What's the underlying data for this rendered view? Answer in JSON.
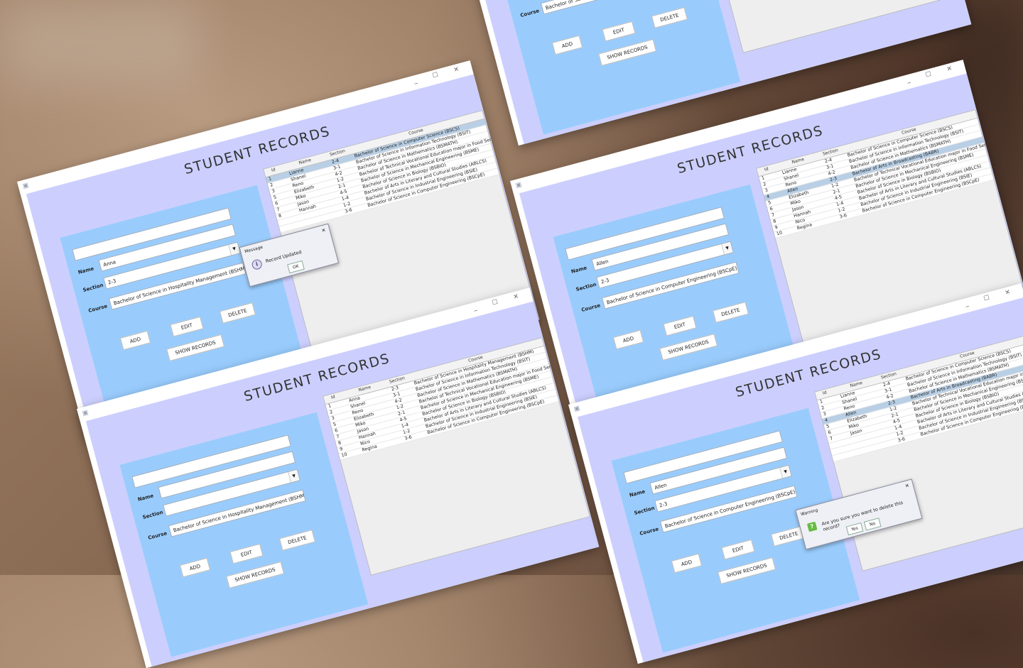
{
  "app": {
    "title": "STUDENT RECORDS",
    "window_controls": "_ ☐ ✕",
    "labels": {
      "name": "Name",
      "section": "Section",
      "course": "Course"
    },
    "buttons": {
      "add": "ADD",
      "edit": "EDIT",
      "delete": "DELETE",
      "show": "SHOW RECORDS"
    },
    "columns": {
      "id": "Id",
      "name": "Name",
      "section": "Section",
      "course": "Course"
    }
  },
  "windows": [
    {
      "form": {
        "name": "Anna",
        "section": "2-3",
        "course": "Bachelor of Science in Hospitality Management (BSHM)"
      },
      "rows": [
        {
          "id": "1",
          "name": "Lianne",
          "section": "2-4",
          "course": "Bachelor of Science in Computer Science (BSCS)"
        },
        {
          "id": "2",
          "name": "Shanel",
          "section": "3-1",
          "course": "Bachelor of Science in Information Technology (BSIT)"
        },
        {
          "id": "3",
          "name": "Reno",
          "section": "4-2",
          "course": "Bachelor of Science in Mathematics (BSMATH)"
        },
        {
          "id": "5",
          "name": "Elizabeth",
          "section": "1-2",
          "course": "Bachelor of Technical Vocational Education major in Food Service M..."
        },
        {
          "id": "6",
          "name": "Miko",
          "section": "2-1",
          "course": "Bachelor of Science in Mechanical Engineering (BSME)"
        },
        {
          "id": "7",
          "name": "Jason",
          "section": "4-5",
          "course": "Bachelor of Science in Biology (BSBIO)"
        },
        {
          "id": "8",
          "name": "Hannah",
          "section": "1-4",
          "course": "Bachelor of Arts in Literary and Cultural Studies (ABLCS)"
        },
        {
          "id": "",
          "name": "",
          "section": "1-2",
          "course": "Bachelor of Science in Industrial Engineering (BSIE)"
        },
        {
          "id": "",
          "name": "",
          "section": "3-6",
          "course": "Bachelor of Science in Computer Engineering (BSCpE)"
        }
      ],
      "dialog": {
        "title": "Message",
        "text": "Record Updated",
        "ok": "OK"
      }
    },
    {
      "form": {
        "name": "",
        "section": "",
        "course": "Bachelor of Science in Hospitality Management (BSHM)"
      },
      "rows": [
        {
          "id": "1",
          "name": "Anna",
          "section": "2-3",
          "course": "Bachelor of Science in Hospitality Management (BSHM)"
        },
        {
          "id": "2",
          "name": "Shanel",
          "section": "3-1",
          "course": "Bachelor of Science in Information Technology (BSIT)"
        },
        {
          "id": "3",
          "name": "Reno",
          "section": "4-2",
          "course": "Bachelor of Science in Mathematics (BSMATH)"
        },
        {
          "id": "5",
          "name": "Elizabeth",
          "section": "1-2",
          "course": "Bachelor of Technical Vocational Education major in Food Service M..."
        },
        {
          "id": "6",
          "name": "Miko",
          "section": "2-1",
          "course": "Bachelor of Science in Mechanical Engineering (BSME)"
        },
        {
          "id": "7",
          "name": "Jason",
          "section": "4-5",
          "course": "Bachelor of Science in Biology (BSBIO)"
        },
        {
          "id": "8",
          "name": "Hannah",
          "section": "1-4",
          "course": "Bachelor of Arts in Literary and Cultural Studies (ABLCS)"
        },
        {
          "id": "9",
          "name": "Nico",
          "section": "1-2",
          "course": "Bachelor of Science in Industrial Engineering (BSIE)"
        },
        {
          "id": "10",
          "name": "Regina",
          "section": "3-6",
          "course": "Bachelor of Science in Computer Engineering (BSCpE)"
        }
      ]
    },
    {
      "form": {
        "name": "",
        "section": "",
        "course": "Bachelor of Science in Computer Science (BSCS)"
      },
      "rows": []
    },
    {
      "form": {
        "name": "Allen",
        "section": "2-3",
        "course": "Bachelor of Science in Computer Engineering (BSCpE)"
      },
      "rows": [
        {
          "id": "1",
          "name": "Lianne",
          "section": "2-4",
          "course": "Bachelor of Science in Computer Science (BSCS)"
        },
        {
          "id": "2",
          "name": "Shanel",
          "section": "3-1",
          "course": "Bachelor of Science in Information Technology (BSIT)"
        },
        {
          "id": "3",
          "name": "Reno",
          "section": "4-2",
          "course": "Bachelor of Science in Mathematics (BSMATH)"
        },
        {
          "id": "4",
          "name": "Allen",
          "section": "2-3",
          "course": "Bachelor of Arts in Broadcasting (BABR)"
        },
        {
          "id": "5",
          "name": "Elizabeth",
          "section": "1-2",
          "course": "Bachelor of Technical Vocational Education major in Food Service M..."
        },
        {
          "id": "6",
          "name": "Miko",
          "section": "2-1",
          "course": "Bachelor of Science in Mechanical Engineering (BSME)"
        },
        {
          "id": "7",
          "name": "Jason",
          "section": "4-5",
          "course": "Bachelor of Science in Biology (BSBIO)"
        },
        {
          "id": "8",
          "name": "Hannah",
          "section": "1-4",
          "course": "Bachelor of Arts in Literary and Cultural Studies (ABLCS)"
        },
        {
          "id": "9",
          "name": "Nico",
          "section": "1-2",
          "course": "Bachelor of Science in Industrial Engineering (BSIE)"
        },
        {
          "id": "10",
          "name": "Regina",
          "section": "3-6",
          "course": "Bachelor of Science in Computer Engineering (BSCpE)"
        }
      ]
    },
    {
      "form": {
        "name": "Allen",
        "section": "2-3",
        "course": "Bachelor of Science in Computer Engineering (BSCpE)"
      },
      "rows": [
        {
          "id": "1",
          "name": "Lianne",
          "section": "2-4",
          "course": "Bachelor of Science in Computer Science (BSCS)"
        },
        {
          "id": "2",
          "name": "Shanel",
          "section": "3-1",
          "course": "Bachelor of Science in Information Technology (BSIT)"
        },
        {
          "id": "3",
          "name": "Reno",
          "section": "4-2",
          "course": "Bachelor of Science in Mathematics (BSMATH)"
        },
        {
          "id": "4",
          "name": "Allen",
          "section": "2-3",
          "course": "Bachelor of Arts in Broadcasting (BABR)"
        },
        {
          "id": "5",
          "name": "Elizabeth",
          "section": "1-2",
          "course": "Bachelor of Technical Vocational Education major in Food Service M..."
        },
        {
          "id": "6",
          "name": "Miko",
          "section": "2-1",
          "course": "Bachelor of Science in Mechanical Engineering (BSME)"
        },
        {
          "id": "7",
          "name": "Jason",
          "section": "4-5",
          "course": "Bachelor of Science in Biology (BSBIO)"
        },
        {
          "id": "",
          "name": "",
          "section": "1-4",
          "course": "Bachelor of Arts in Literary and Cultural Studies (ABLCS)"
        },
        {
          "id": "",
          "name": "",
          "section": "1-2",
          "course": "Bachelor of Science in Industrial Engineering (BSIE)"
        },
        {
          "id": "",
          "name": "",
          "section": "3-6",
          "course": "Bachelor of Science in Computer Engineering (BSCpE)"
        }
      ],
      "dialog": {
        "title": "Warning",
        "text": "Are you sure you want to delete this record?",
        "yes": "Yes",
        "no": "No"
      }
    }
  ]
}
